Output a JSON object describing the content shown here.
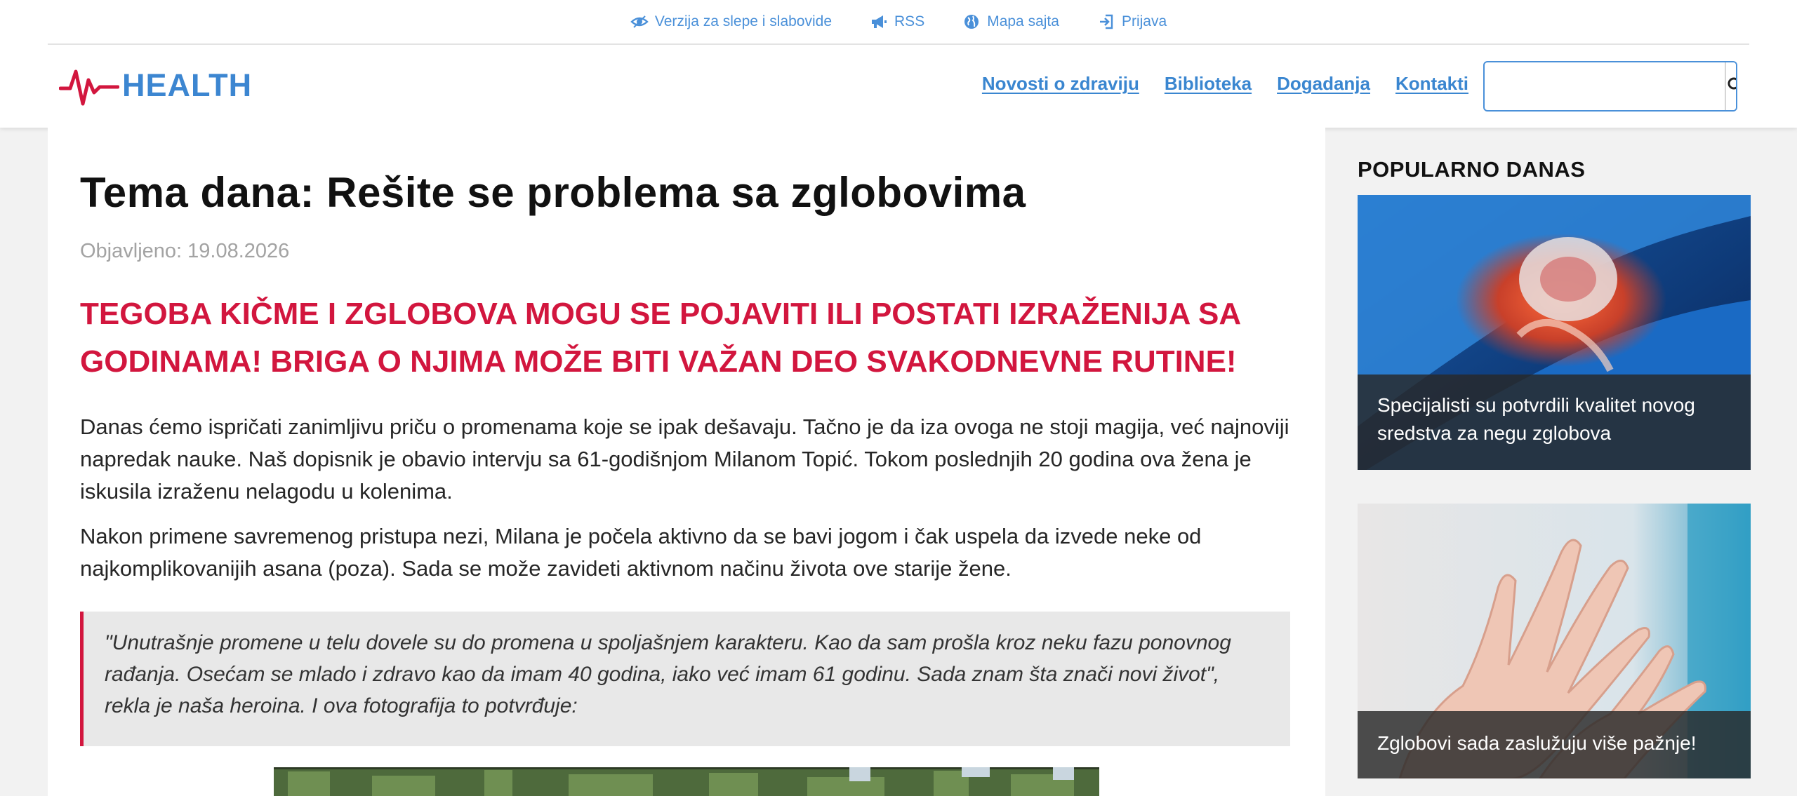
{
  "topbar": {
    "links": [
      {
        "label": "Verzija za slepe i slabovide",
        "icon": "eye-icon"
      },
      {
        "label": "RSS",
        "icon": "megaphone-icon"
      },
      {
        "label": "Mapa sajta",
        "icon": "globe-icon"
      },
      {
        "label": "Prijava",
        "icon": "login-icon"
      }
    ]
  },
  "header": {
    "logo_text": "HEALTH",
    "nav": [
      "Novosti o zdraviju",
      "Biblioteka",
      "Dogadanja",
      "Kontakti"
    ],
    "search": {
      "value": "",
      "placeholder": ""
    }
  },
  "article": {
    "title": "Tema dana: Rešite se problema sa zglobovima",
    "published": "Objavljeno: 19.08.2026",
    "headline": "TEGOBA KIČME I ZGLOBOVA MOGU SE POJAVITI ILI POSTATI IZRAŽENIJA SA GODINAMA! BRIGA O NJIMA MOŽE BITI VAŽAN DEO SVAKODNEVNE RUTINE!",
    "paragraphs": [
      "Danas ćemo ispričati zanimljivu priču o promenama koje se ipak dešavaju. Tačno je da iza ovoga ne stoji magija, već najnoviji napredak nauke. Naš dopisnik je obavio intervju sa 61-godišnjom Milanom Topić. Tokom poslednjih 20 godina ova žena je iskusila izraženu nelagodu u kolenima.",
      "Nakon primene savremenog pristupa nezi, Milana je počela aktivno da se bavi jogom i čak uspela da izvede neke od najkomplikovanijih asana (poza). Sada se može zavideti aktivnom načinu života ove starije žene."
    ],
    "quote": "\"Unutrašnje promene u telu dovele su do promena u spoljašnjem karakteru. Kao da sam prošla kroz neku fazu ponovnog rađanja. Osećam se mlado i zdravo kao da imam 40 godina, iako već imam 61 godinu. Sada znam šta znači novi život\", rekla je naša heroina. I ova fotografija to potvrđuje:"
  },
  "sidebar": {
    "title": "POPULARNO DANAS",
    "cards": [
      {
        "caption": "Specijalisti su potvrdili kvalitet novog sredstva za negu zglobova"
      },
      {
        "caption": "Zglobovi sada zaslužuju više pažnje!"
      }
    ]
  },
  "colors": {
    "accent_blue": "#3c86d1",
    "headline_red": "#d2163e",
    "logo_pulse_red": "#d2163e"
  }
}
